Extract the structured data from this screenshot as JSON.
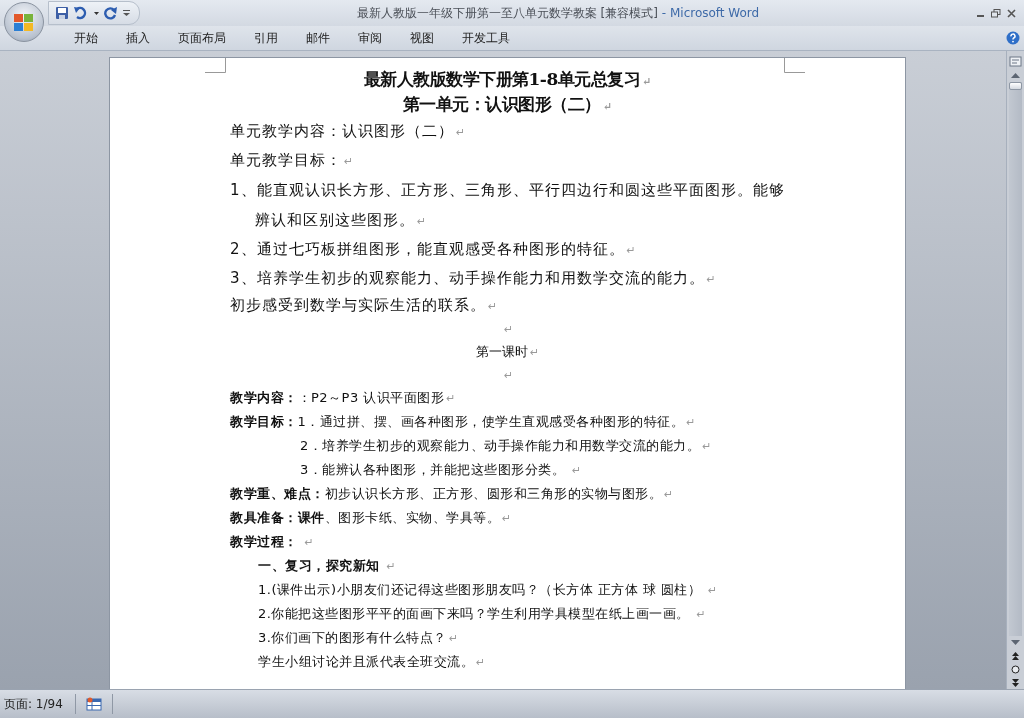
{
  "window": {
    "title": "最新人教版一年级下册第一至八单元数学教案 [兼容模式]",
    "app_name": "- Microsoft Word"
  },
  "ribbon_tabs": [
    {
      "label": "开始"
    },
    {
      "label": "插入"
    },
    {
      "label": "页面布局"
    },
    {
      "label": "引用"
    },
    {
      "label": "邮件"
    },
    {
      "label": "审阅"
    },
    {
      "label": "视图"
    },
    {
      "label": "开发工具"
    }
  ],
  "document": {
    "paragraphs": [
      {
        "kind": "title",
        "text": "最新人教版数学下册第1-8单元总复习",
        "mark": "↵"
      },
      {
        "kind": "title",
        "text": "第一单元：认识图形（二）",
        "mark": "↵"
      },
      {
        "kind": "body",
        "text": "单元教学内容：认识图形（二）",
        "mark": "↵"
      },
      {
        "kind": "body",
        "text": "单元教学目标：",
        "mark": "↵"
      },
      {
        "kind": "hanging",
        "text": "1、能直观认识长方形、正方形、三角形、平行四边行和圆这些平面图形。能够辨认和区别这些图形。",
        "mark": "↵"
      },
      {
        "kind": "body",
        "text": "2、通过七巧板拼组图形，能直观感受各种图形的特征。",
        "mark": "↵"
      },
      {
        "kind": "body",
        "text": "3、培养学生初步的观察能力、动手操作能力和用数学交流的能力。",
        "mark": "↵"
      },
      {
        "kind": "body_tight",
        "text": "初步感受到数学与实际生活的联系。",
        "mark": "↵"
      },
      {
        "kind": "center",
        "mark": "↵"
      },
      {
        "kind": "center",
        "text": "第一课时",
        "mark": "↵"
      },
      {
        "kind": "center",
        "mark": "↵"
      },
      {
        "kind": "small",
        "text": "**教学内容：**：P2～P3  认识平面图形",
        "mark": "↵"
      },
      {
        "kind": "small",
        "text": "**教学目标：**1．通过拼、摆、画各种图形，使学生直观感受各种图形的特征。",
        "mark": "↵"
      },
      {
        "kind": "small_indent",
        "text": "2．培养学生初步的观察能力、动手操作能力和用数学交流的能力。",
        "mark": "↵"
      },
      {
        "kind": "small_indent",
        "text": "3．能辨认各种图形，并能把这些图形分类。 ",
        "mark": "↵"
      },
      {
        "kind": "small",
        "text": "**教学重、难点：**初步认识长方形、正方形、圆形和三角形的实物与图形。",
        "mark": "↵"
      },
      {
        "kind": "small",
        "text": "**教具准备：课件**、图形卡纸、实物、学具等。",
        "mark": "↵"
      },
      {
        "kind": "small_bold",
        "text": "教学过程： ",
        "mark": "↵"
      },
      {
        "kind": "sub_bold",
        "text": "一、复习，探究新知 ",
        "mark": "↵"
      },
      {
        "kind": "sub",
        "text": "1.(课件出示)小朋友们还记得这些图形朋友吗？（长方体  正方体  球  圆柱） ",
        "mark": "↵"
      },
      {
        "kind": "sub",
        "text": "2.你能把这些图形平平的面画下来吗？学生利用学具模型在纸上画一画。 ",
        "mark": "↵"
      },
      {
        "kind": "sub",
        "text": "3.你们画下的图形有什么特点？",
        "mark": "↵"
      },
      {
        "kind": "sub",
        "text": "学生小组讨论并且派代表全班交流。",
        "mark": "↵"
      }
    ]
  },
  "status_bar": {
    "page": "页面: 1/94"
  }
}
